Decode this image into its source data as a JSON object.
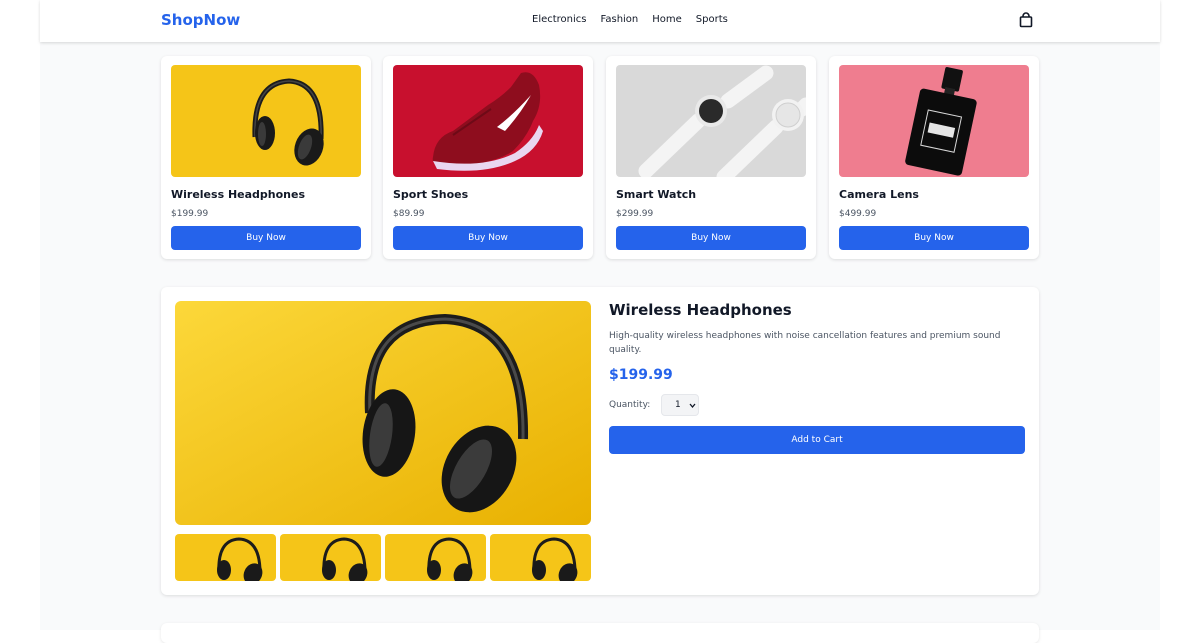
{
  "nav": {
    "brand": "ShopNow",
    "links": [
      "Electronics",
      "Fashion",
      "Home",
      "Sports"
    ],
    "cart_icon": "shopping-bag-icon"
  },
  "products": [
    {
      "name": "Wireless Headphones",
      "price": "$199.99",
      "button": "Buy Now",
      "image": "headphones"
    },
    {
      "name": "Sport Shoes",
      "price": "$89.99",
      "button": "Buy Now",
      "image": "sneaker"
    },
    {
      "name": "Smart Watch",
      "price": "$299.99",
      "button": "Buy Now",
      "image": "smartwatch"
    },
    {
      "name": "Camera Lens",
      "price": "$499.99",
      "button": "Buy Now",
      "image": "perfume-bottle"
    }
  ],
  "detail": {
    "title": "Wireless Headphones",
    "description": "High-quality wireless headphones with noise cancellation features and premium sound quality.",
    "price": "$199.99",
    "quantity_label": "Quantity:",
    "quantity_value": "1",
    "add_button": "Add to Cart",
    "thumbnail_count": 4
  },
  "colors": {
    "accent": "#2563eb",
    "page_bg": "#f9fafb",
    "headphones_bg": "#f5c518",
    "shoe_bg": "#c8102e",
    "watch_bg": "#d9d9d9",
    "perfume_bg": "#ef7d8f"
  }
}
